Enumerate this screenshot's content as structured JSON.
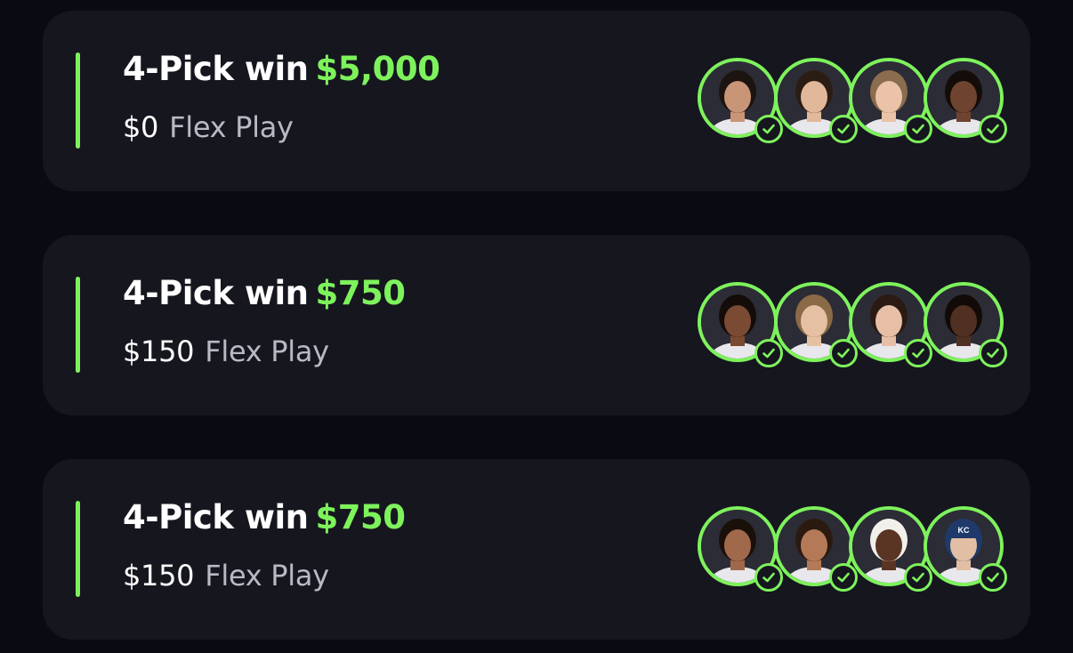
{
  "colors": {
    "background": "#0a0a12",
    "card": "#16161f",
    "accent_green": "#7ef25c",
    "primary_text": "#ffffff",
    "secondary_text": "#b9b9c4"
  },
  "entries": [
    {
      "pick_label": "4-Pick win",
      "win_amount": "$5,000",
      "stake": "$0",
      "play_type": "Flex Play",
      "players": [
        {
          "icon": "player-headshot",
          "status_icon": "check-icon",
          "skin": "#c99577",
          "hair": "#1c1410"
        },
        {
          "icon": "player-headshot",
          "status_icon": "check-icon",
          "skin": "#e1b89a",
          "hair": "#2c1d14"
        },
        {
          "icon": "player-headshot",
          "status_icon": "check-icon",
          "skin": "#eac3a8",
          "hair": "#8a6c4e"
        },
        {
          "icon": "player-headshot",
          "status_icon": "check-icon",
          "skin": "#6e4430",
          "hair": "#140c08"
        }
      ]
    },
    {
      "pick_label": "4-Pick win",
      "win_amount": "$750",
      "stake": "$150",
      "play_type": "Flex Play",
      "players": [
        {
          "icon": "player-headshot",
          "status_icon": "check-icon",
          "skin": "#7a4a33",
          "hair": "#140c08"
        },
        {
          "icon": "player-headshot",
          "status_icon": "check-icon",
          "skin": "#e5c0a2",
          "hair": "#8b6a47"
        },
        {
          "icon": "player-headshot",
          "status_icon": "check-icon",
          "skin": "#e6bfa6",
          "hair": "#2a1a12"
        },
        {
          "icon": "player-headshot",
          "status_icon": "check-icon",
          "skin": "#4f3022",
          "hair": "#120a06"
        }
      ]
    },
    {
      "pick_label": "4-Pick win",
      "win_amount": "$750",
      "stake": "$150",
      "play_type": "Flex Play",
      "players": [
        {
          "icon": "player-headshot",
          "status_icon": "check-icon",
          "skin": "#a0694b",
          "hair": "#1a100a"
        },
        {
          "icon": "player-headshot",
          "status_icon": "check-icon",
          "skin": "#b47a57",
          "hair": "#2a1a10"
        },
        {
          "icon": "player-headshot",
          "status_icon": "check-icon",
          "skin": "#5a3524",
          "hair": "#f2f0ea"
        },
        {
          "icon": "player-headshot",
          "status_icon": "check-icon",
          "skin": "#e2bfa4",
          "hair": "#1f3a6a",
          "cap_text": "KC"
        }
      ]
    }
  ]
}
